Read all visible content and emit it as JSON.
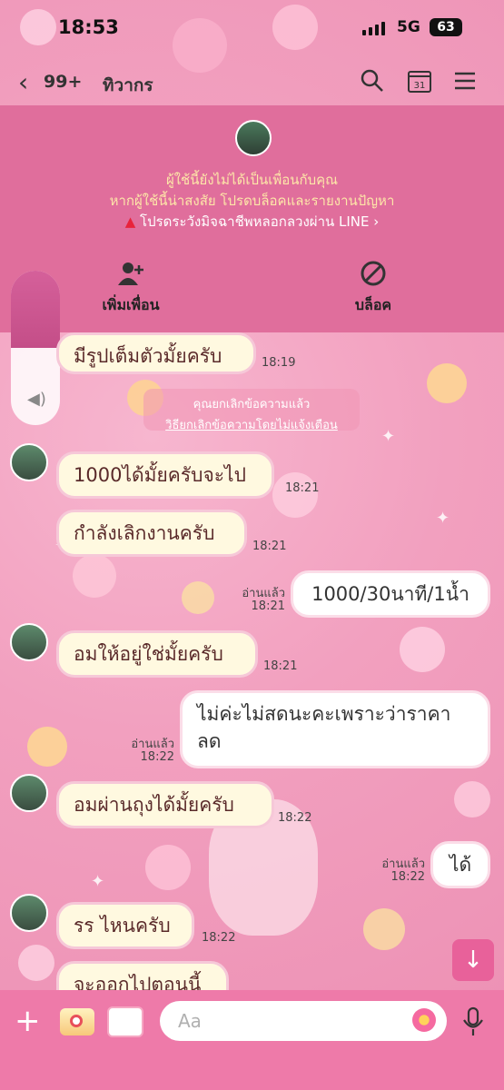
{
  "status_bar": {
    "time": "18:53",
    "network": "5G",
    "battery": "63"
  },
  "header": {
    "back_icon": "chevron-left-icon",
    "unread_count": "99+",
    "chat_name": "ทิวากร"
  },
  "panel": {
    "line1": "ผู้ใช้นี้ยังไม่ได้เป็นเพื่อนกับคุณ",
    "line2": "หากผู้ใช้นี้น่าสงสัย โปรดบล็อคและรายงานปัญหา",
    "warning": "โปรดระวังมิจฉาชีพหลอกลวงผ่าน LINE",
    "add_friend": "เพิ่มเพื่อน",
    "block": "บล็อค"
  },
  "unsend_notice": {
    "text": "คุณยกเลิกข้อความแล้ว",
    "link": "วิธียกเลิกข้อความโดยไม่แจ้งเตือน"
  },
  "messages": [
    {
      "text": "มีรูปเต็มตัวมั้ยครับ",
      "time": "18:19"
    },
    {
      "text": "1000ได้มั้ยครับจะไป",
      "time": "18:21"
    },
    {
      "text": "กำลังเลิกงานครับ",
      "time": "18:21"
    },
    {
      "text": "1000/30นาที/1น้ำ",
      "time": "18:21",
      "read": "อ่านแล้ว"
    },
    {
      "text": "อมให้อยู่ใช่มั้ยครับ",
      "time": "18:21"
    },
    {
      "text_line1": "ไม่ค่ะไม่สดนะคะเพราะว่าราคา",
      "text_line2": "ลด",
      "time": "18:22",
      "read": "อ่านแล้ว"
    },
    {
      "text": "อมผ่านถุงได้มั้ยครับ",
      "time": "18:22"
    },
    {
      "text": "ได้",
      "time": "18:22",
      "read": "อ่านแล้ว"
    },
    {
      "text": "รร ไหนครับ",
      "time": "18:22"
    },
    {
      "text": "จะออกไปตอนนี้"
    }
  ],
  "input": {
    "placeholder": "Aa"
  }
}
